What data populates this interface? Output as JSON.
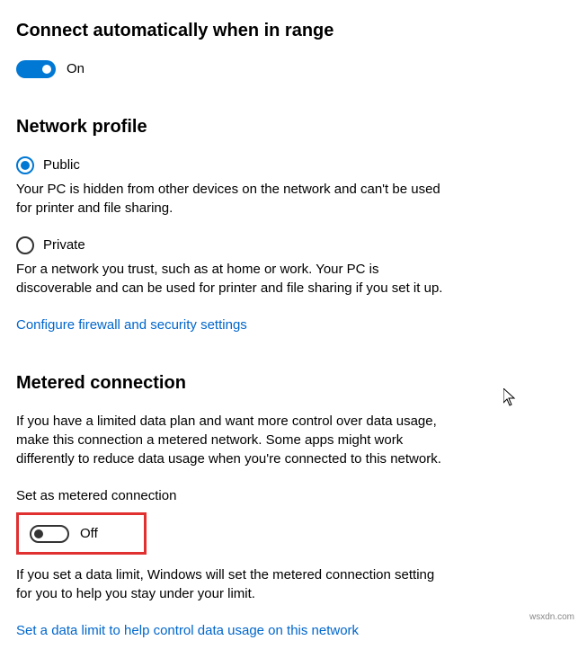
{
  "connect": {
    "title": "Connect automatically when in range",
    "toggle_state": "On"
  },
  "profile": {
    "title": "Network profile",
    "public": {
      "label": "Public",
      "desc": "Your PC is hidden from other devices on the network and can't be used for printer and file sharing."
    },
    "private": {
      "label": "Private",
      "desc": "For a network you trust, such as at home or work. Your PC is discoverable and can be used for printer and file sharing if you set it up."
    },
    "firewall_link": "Configure firewall and security settings"
  },
  "metered": {
    "title": "Metered connection",
    "desc": "If you have a limited data plan and want more control over data usage, make this connection a metered network. Some apps might work differently to reduce data usage when you're connected to this network.",
    "set_label": "Set as metered connection",
    "toggle_state": "Off",
    "limit_desc": "If you set a data limit, Windows will set the metered connection setting for you to help you stay under your limit.",
    "limit_link": "Set a data limit to help control data usage on this network"
  },
  "watermark": "wsxdn.com"
}
